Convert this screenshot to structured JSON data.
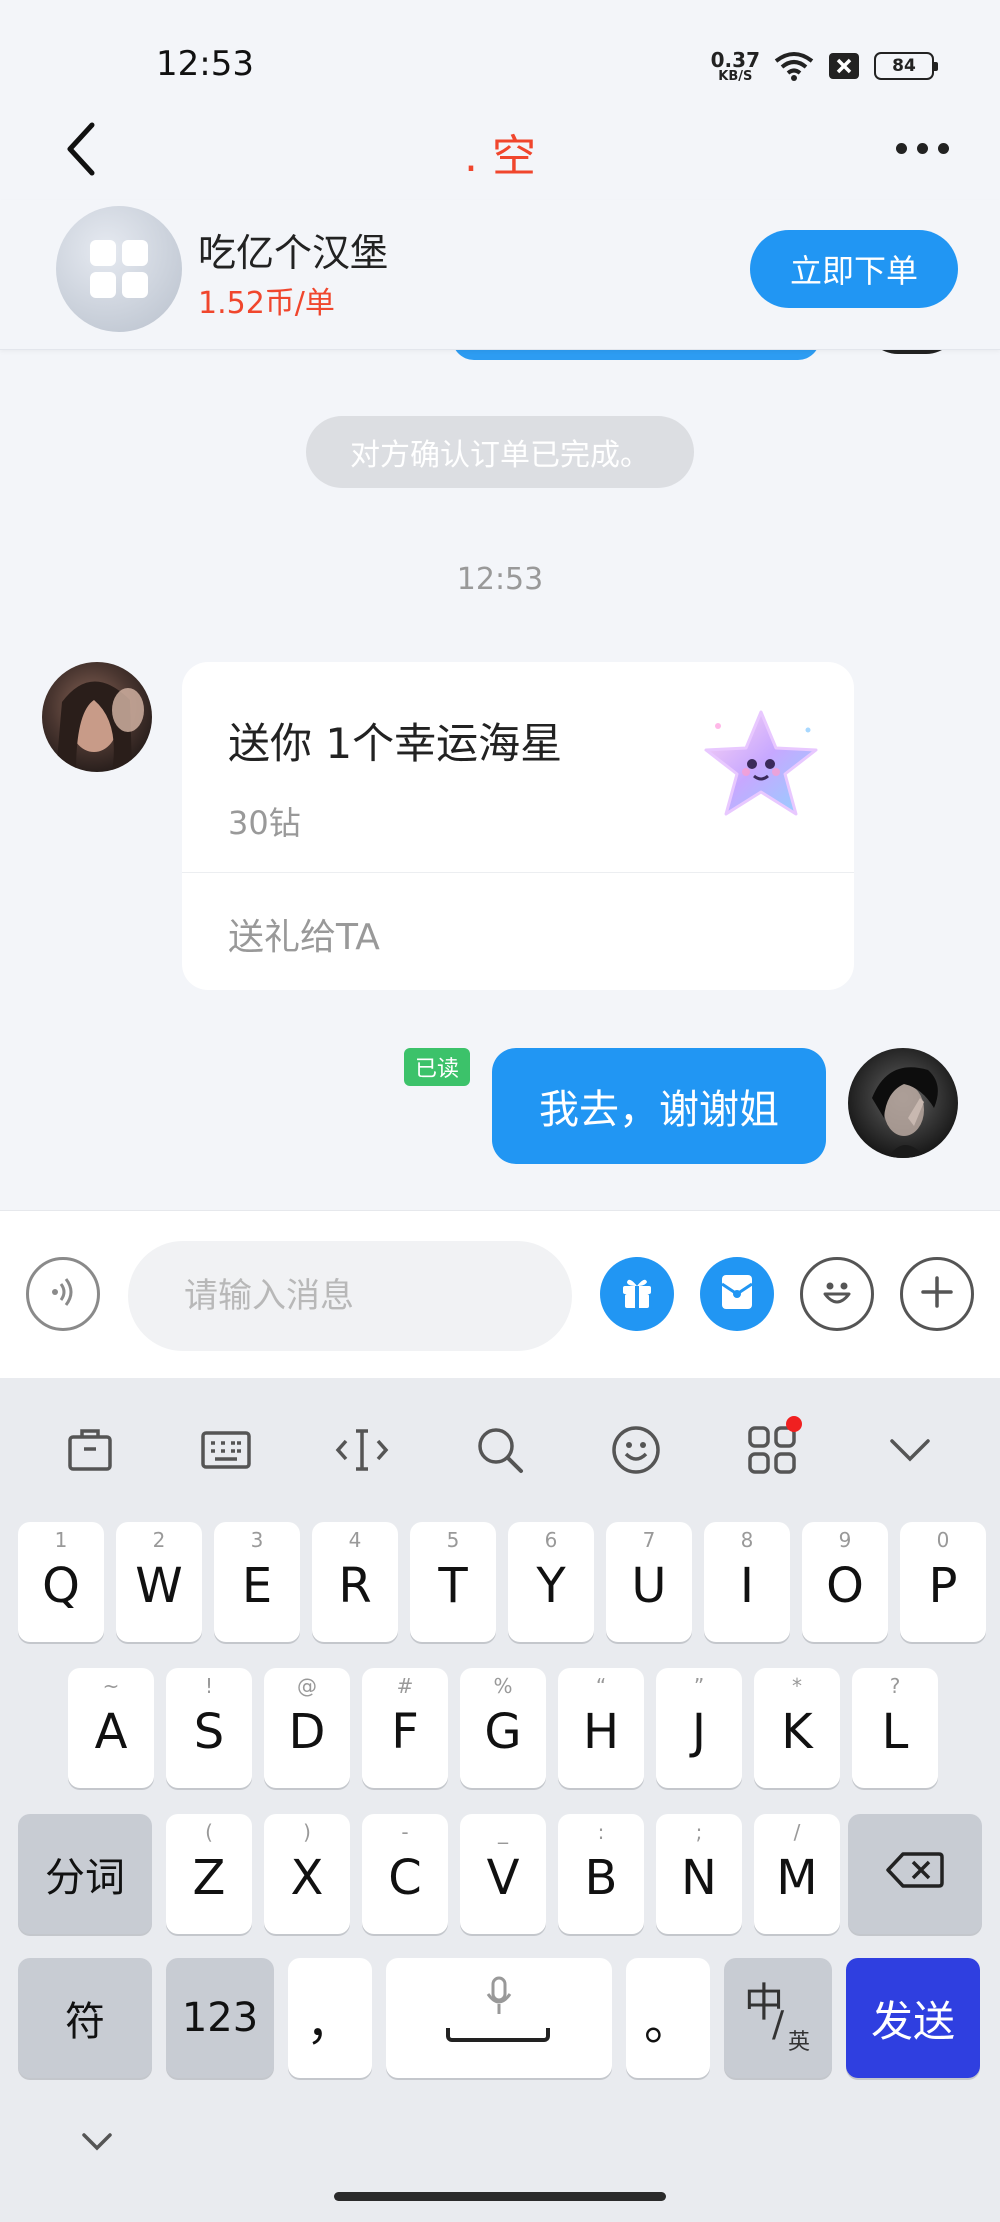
{
  "status_bar": {
    "time": "12:53",
    "net_speed_value": "0.37",
    "net_speed_unit": "KB/S",
    "battery": "84"
  },
  "header": {
    "title": ". 空"
  },
  "product": {
    "name": "吃亿个汉堡",
    "price": "1.52币/单",
    "order_button": "立即下单"
  },
  "chat": {
    "system_message": "对方确认订单已完成。",
    "timestamp": "12:53",
    "gift_card": {
      "title": "送你 1个幸运海星",
      "price": "30钻",
      "action": "送礼给TA"
    },
    "read_badge": "已读",
    "my_message": "我去，谢谢姐"
  },
  "input_bar": {
    "placeholder": "请输入消息"
  },
  "keyboard": {
    "row1": [
      {
        "hint": "1",
        "key": "Q"
      },
      {
        "hint": "2",
        "key": "W"
      },
      {
        "hint": "3",
        "key": "E"
      },
      {
        "hint": "4",
        "key": "R"
      },
      {
        "hint": "5",
        "key": "T"
      },
      {
        "hint": "6",
        "key": "Y"
      },
      {
        "hint": "7",
        "key": "U"
      },
      {
        "hint": "8",
        "key": "I"
      },
      {
        "hint": "9",
        "key": "O"
      },
      {
        "hint": "0",
        "key": "P"
      }
    ],
    "row2": [
      {
        "hint": "~",
        "key": "A"
      },
      {
        "hint": "!",
        "key": "S"
      },
      {
        "hint": "@",
        "key": "D"
      },
      {
        "hint": "#",
        "key": "F"
      },
      {
        "hint": "%",
        "key": "G"
      },
      {
        "hint": "“",
        "key": "H"
      },
      {
        "hint": "”",
        "key": "J"
      },
      {
        "hint": "*",
        "key": "K"
      },
      {
        "hint": "?",
        "key": "L"
      }
    ],
    "row3": [
      {
        "hint": "(",
        "key": "Z"
      },
      {
        "hint": ")",
        "key": "X"
      },
      {
        "hint": "-",
        "key": "C"
      },
      {
        "hint": "_",
        "key": "V"
      },
      {
        "hint": ":",
        "key": "B"
      },
      {
        "hint": ";",
        "key": "N"
      },
      {
        "hint": "/",
        "key": "M"
      }
    ],
    "segment_key": "分词",
    "symbol_key": "符",
    "number_key": "123",
    "comma_key": "，",
    "period_key": "。",
    "lang_key_main": "中",
    "lang_key_slash": "/",
    "lang_key_sub": "英",
    "send_key": "发送"
  },
  "colors": {
    "accent_blue": "#2196f3",
    "title_red": "#f0462d",
    "send_key": "#2f3fe0",
    "read_badge": "#3cc26a"
  },
  "icons": {
    "back": "chevron-left-icon",
    "more": "more-dots-icon",
    "voice": "voice-icon",
    "gift": "gift-icon",
    "red_packet": "red-packet-icon",
    "emoji": "smiley-icon",
    "plus": "plus-icon",
    "backspace": "backspace-icon",
    "mic": "mic-icon"
  }
}
